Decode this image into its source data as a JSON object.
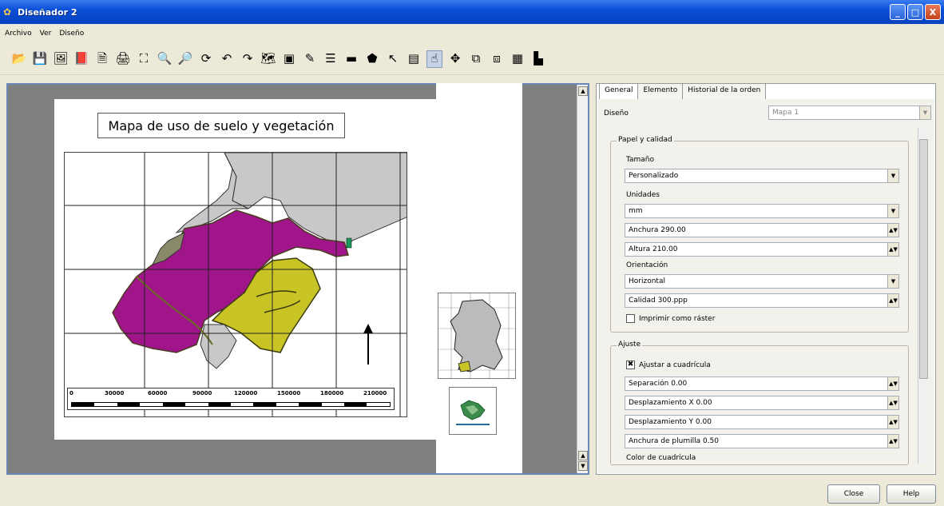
{
  "window": {
    "title": "Diseñador 2",
    "controls": [
      "_",
      "□",
      "X"
    ]
  },
  "menu": [
    "Archivo",
    "Ver",
    "Diseño"
  ],
  "toolbar_icons": [
    "open-template-icon",
    "save-template-icon",
    "export-image-icon",
    "export-pdf-icon",
    "export-svg-icon",
    "print-icon",
    "zoom-full-icon",
    "zoom-in-icon",
    "zoom-out-icon",
    "refresh-icon",
    "undo-icon",
    "redo-icon",
    "add-map-icon",
    "add-image-icon",
    "add-label-icon",
    "add-legend-icon",
    "add-scalebar-icon",
    "add-shape-icon",
    "add-arrow-icon",
    "add-table-icon",
    "select-move-icon",
    "move-content-icon",
    "group-icon",
    "ungroup-icon",
    "raise-icon",
    "align-icon"
  ],
  "toolbar_glyphs": [
    "📂",
    "💾",
    "🖼",
    "📕",
    "🗎",
    "🖨",
    "⛶",
    "🔍",
    "🔎",
    "⟳",
    "↶",
    "↷",
    "🗺",
    "▣",
    "✎",
    "☰",
    "▬",
    "⬟",
    "↖",
    "▤",
    "☝",
    "✥",
    "⧉",
    "⧈",
    "▦",
    "▙"
  ],
  "map": {
    "title": "Mapa de uso de suelo y vegetación",
    "scale_labels": [
      "0",
      "30000",
      "60000",
      "90000",
      "120000",
      "150000",
      "180000",
      "210000"
    ],
    "colors": {
      "purple": "#a0168a",
      "yellow": "#c8c425",
      "gray": "#c8c8c8",
      "olive": "#8a8a6a"
    }
  },
  "tabs": [
    "General",
    "Elemento",
    "Historial de la orden"
  ],
  "panel": {
    "diseno_label": "Diseño",
    "diseno_value": "Mapa 1",
    "papel": {
      "title": "Papel y calidad",
      "tamano_label": "Tamaño",
      "tamano_value": "Personalizado",
      "unidades_label": "Unidades",
      "unidades_value": "mm",
      "anchura": "Anchura 290.00",
      "altura": "Altura 210.00",
      "orientacion_label": "Orientación",
      "orientacion_value": "Horizontal",
      "calidad": "Calidad 300.ppp",
      "raster_label": "Imprimir como ráster"
    },
    "ajuste": {
      "title": "Ajuste",
      "ajustar_label": "Ajustar a cuadrícula",
      "ajustar_checked": "✖",
      "separacion": "Separación 0.00",
      "desp_x": "Desplazamiento X 0.00",
      "desp_y": "Desplazamiento Y 0.00",
      "plumilla": "Anchura de plumilla 0.50",
      "color_label": "Color de cuadrícula"
    }
  },
  "buttons": {
    "close": "Close",
    "help": "Help"
  }
}
